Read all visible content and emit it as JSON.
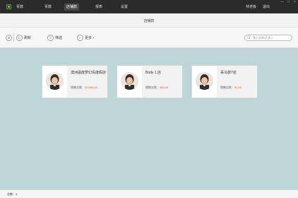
{
  "app": {
    "title": "青数"
  },
  "nav": [
    {
      "label": "青数",
      "active": false
    },
    {
      "label": "店铺款",
      "active": true
    },
    {
      "label": "报表",
      "active": false
    },
    {
      "label": "设置",
      "active": false
    }
  ],
  "user": {
    "name": "林老板",
    "logout": "退出"
  },
  "window_controls": [
    "—",
    "□",
    "×"
  ],
  "page_title": "店铺款",
  "toolbar": {
    "refresh_label": "刷新",
    "filter_label": "筛选",
    "more_label": "更多",
    "search_placeholder": "客户名称/负责人"
  },
  "cards": [
    {
      "name": "澳洲温度梦幻岛度假店",
      "sales_label": "销售欠款：",
      "amount": "10,996.00"
    },
    {
      "name": "Body 1 店",
      "sales_label": "销售欠款：",
      "amount": "500.00"
    },
    {
      "name": "哥马旅7店",
      "sales_label": "销售欠款：",
      "amount": "50.00"
    }
  ],
  "status": {
    "total_label": "总数：",
    "total_value": "3"
  },
  "colors": {
    "topbar": "#2b2b2b",
    "background": "#bfd6d8",
    "accent_amount": "#e0533a",
    "logo": "#6fb341"
  }
}
